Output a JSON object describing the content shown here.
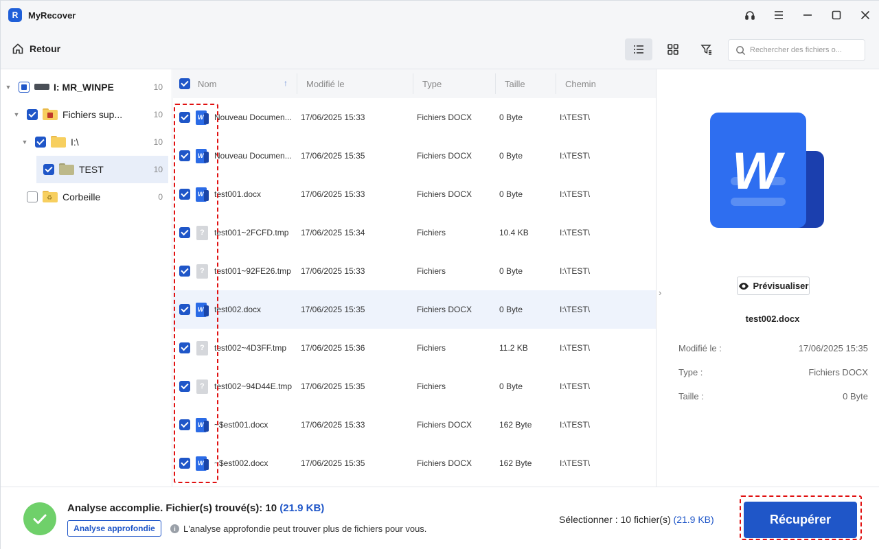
{
  "app": {
    "title": "MyRecover",
    "logo_letter": "R"
  },
  "toolbar": {
    "back_label": "Retour",
    "search_placeholder": "Rechercher des fichiers o..."
  },
  "sidebar": {
    "items": [
      {
        "label": "I: MR_WINPE",
        "count": "10",
        "state": "partial",
        "icon": "drive-icon"
      },
      {
        "label": "Fichiers sup...",
        "count": "10",
        "state": "checked",
        "icon": "deleted-folder-icon"
      },
      {
        "label": "I:\\",
        "count": "10",
        "state": "checked",
        "icon": "folder-icon"
      },
      {
        "label": "TEST",
        "count": "10",
        "state": "checked",
        "icon": "folder-icon",
        "selected": true
      },
      {
        "label": "Corbeille",
        "count": "0",
        "state": "unchecked",
        "icon": "recycle-folder-icon"
      }
    ]
  },
  "list": {
    "columns": {
      "name": "Nom",
      "modified": "Modifié le",
      "type": "Type",
      "size": "Taille",
      "path": "Chemin"
    },
    "rows": [
      {
        "name": "Nouveau Documen...",
        "modified": "17/06/2025 15:33",
        "type": "Fichiers DOCX",
        "size": "0 Byte",
        "path": "I:\\TEST\\",
        "icon": "word"
      },
      {
        "name": "Nouveau Documen...",
        "modified": "17/06/2025 15:35",
        "type": "Fichiers DOCX",
        "size": "0 Byte",
        "path": "I:\\TEST\\",
        "icon": "word"
      },
      {
        "name": "test001.docx",
        "modified": "17/06/2025 15:33",
        "type": "Fichiers DOCX",
        "size": "0 Byte",
        "path": "I:\\TEST\\",
        "icon": "word"
      },
      {
        "name": "test001~2FCFD.tmp",
        "modified": "17/06/2025 15:34",
        "type": "Fichiers",
        "size": "10.4 KB",
        "path": "I:\\TEST\\",
        "icon": "unknown"
      },
      {
        "name": "test001~92FE26.tmp",
        "modified": "17/06/2025 15:33",
        "type": "Fichiers",
        "size": "0 Byte",
        "path": "I:\\TEST\\",
        "icon": "unknown"
      },
      {
        "name": "test002.docx",
        "modified": "17/06/2025 15:35",
        "type": "Fichiers DOCX",
        "size": "0 Byte",
        "path": "I:\\TEST\\",
        "icon": "word",
        "selected": true
      },
      {
        "name": "test002~4D3FF.tmp",
        "modified": "17/06/2025 15:36",
        "type": "Fichiers",
        "size": "11.2 KB",
        "path": "I:\\TEST\\",
        "icon": "unknown"
      },
      {
        "name": "test002~94D44E.tmp",
        "modified": "17/06/2025 15:35",
        "type": "Fichiers",
        "size": "0 Byte",
        "path": "I:\\TEST\\",
        "icon": "unknown"
      },
      {
        "name": "~$est001.docx",
        "modified": "17/06/2025 15:33",
        "type": "Fichiers DOCX",
        "size": "162 Byte",
        "path": "I:\\TEST\\",
        "icon": "word"
      },
      {
        "name": "~$est002.docx",
        "modified": "17/06/2025 15:35",
        "type": "Fichiers DOCX",
        "size": "162 Byte",
        "path": "I:\\TEST\\",
        "icon": "word"
      }
    ]
  },
  "preview": {
    "button_label": "Prévisualiser",
    "file_name": "test002.docx",
    "meta": [
      {
        "label": "Modifié le :",
        "value": "17/06/2025 15:35"
      },
      {
        "label": "Type :",
        "value": "Fichiers DOCX"
      },
      {
        "label": "Taille :",
        "value": "0 Byte"
      }
    ]
  },
  "bottom": {
    "status_text": "Analyse accomplie. Fichier(s) trouvé(s): 10",
    "status_size": "(21.9 KB)",
    "deep_scan_label": "Analyse approfondie",
    "hint": "L'analyse approfondie peut trouver plus de fichiers pour vous.",
    "selection_text": "Sélectionner : 10 fichier(s)",
    "selection_size": "(21.9 KB)",
    "recover_label": "Récupérer"
  },
  "colors": {
    "accent": "#1f56c8",
    "success": "#6fd06a",
    "highlight": "#e01010"
  }
}
